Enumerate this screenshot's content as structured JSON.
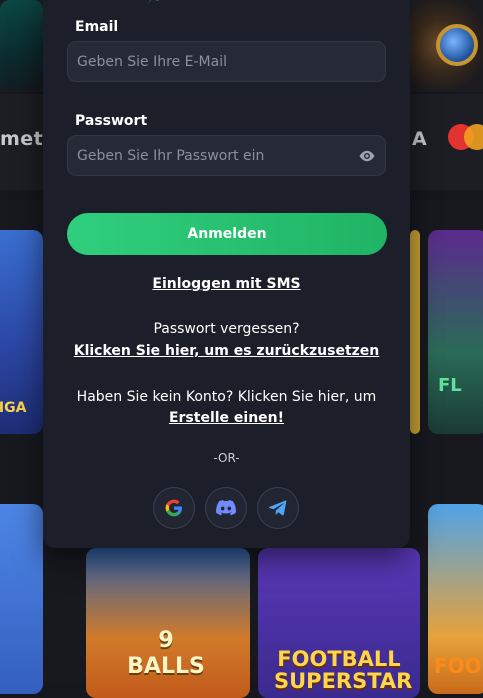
{
  "login": {
    "email_label": "Email",
    "email_placeholder": "Geben Sie Ihre E-Mail",
    "password_label": "Passwort",
    "password_placeholder": "Geben Sie Ihr Passwort ein",
    "submit_label": "Anmelden",
    "sms_login": "Einloggen mit SMS",
    "forgot_text": "Passwort vergessen?",
    "reset_link": "Klicken Sie hier, um es zurückzusetzen",
    "no_account_text": "Haben Sie kein Konto? Klicken Sie hier, um",
    "create_link": "Erstelle einen!",
    "or_divider": "-OR-",
    "social": [
      {
        "icon": "google-icon"
      },
      {
        "icon": "discord-icon"
      },
      {
        "icon": "telegram-icon"
      }
    ],
    "accent_color": "#2fcf7d"
  },
  "background": {
    "payment_left_text": "meth",
    "payment_right_text": "A",
    "games": [
      {
        "label": "LIGA"
      },
      {
        "label": "FL"
      },
      {
        "label": "9 BALLS"
      },
      {
        "label": "FOOTBALL SUPERSTAR"
      },
      {
        "label": "FOO"
      }
    ]
  }
}
